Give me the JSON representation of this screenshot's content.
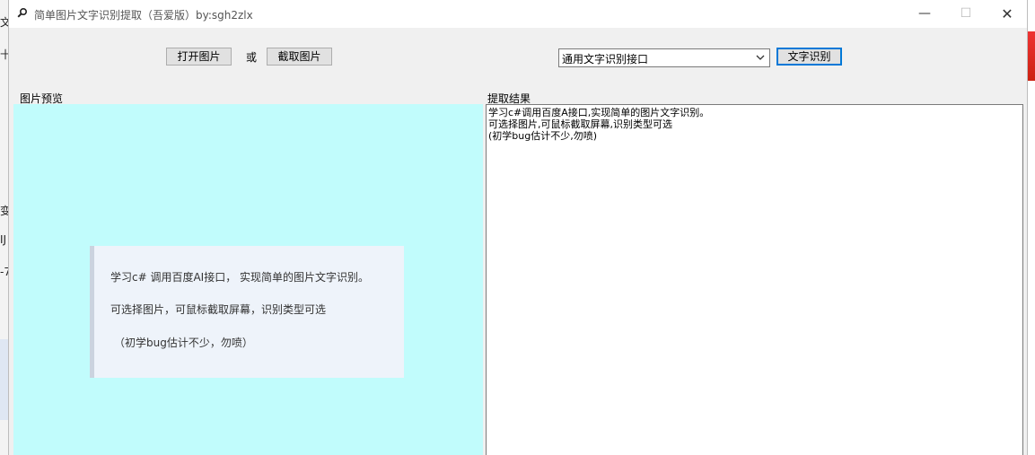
{
  "window": {
    "title": "简单图片文字识别提取（吾爱版）by:sgh2zlx",
    "icon": "magnifier-icon",
    "controls": {
      "minimize": "—",
      "maximize": "☐",
      "close": "✕"
    }
  },
  "toolbar": {
    "open_image_label": "打开图片",
    "or_label": "或",
    "capture_image_label": "截取图片",
    "api_select_value": "通用文字识别接口",
    "recognize_label": "文字识别"
  },
  "preview": {
    "label": "图片预览",
    "card_lines": [
      "学习c# 调用百度AI接口， 实现简单的图片文字识别。",
      "可选择图片，可鼠标截取屏幕，识别类型可选",
      "（初学bug估计不少，勿喷）"
    ]
  },
  "result": {
    "label": "提取结果",
    "lines": [
      "学习c#调用百度A接口,实现简单的图片文字识别。",
      "可选择图片,可鼠标截取屏幕,识别类型可选",
      "(初学bug估计不少,勿喷)"
    ]
  },
  "background": {
    "left_fragments": [
      "文",
      "十",
      "变",
      "IJ",
      "-7"
    ]
  },
  "colors": {
    "preview_bg": "#c1fcfc",
    "card_bg": "#eef3fa",
    "accent": "#0078d7"
  }
}
